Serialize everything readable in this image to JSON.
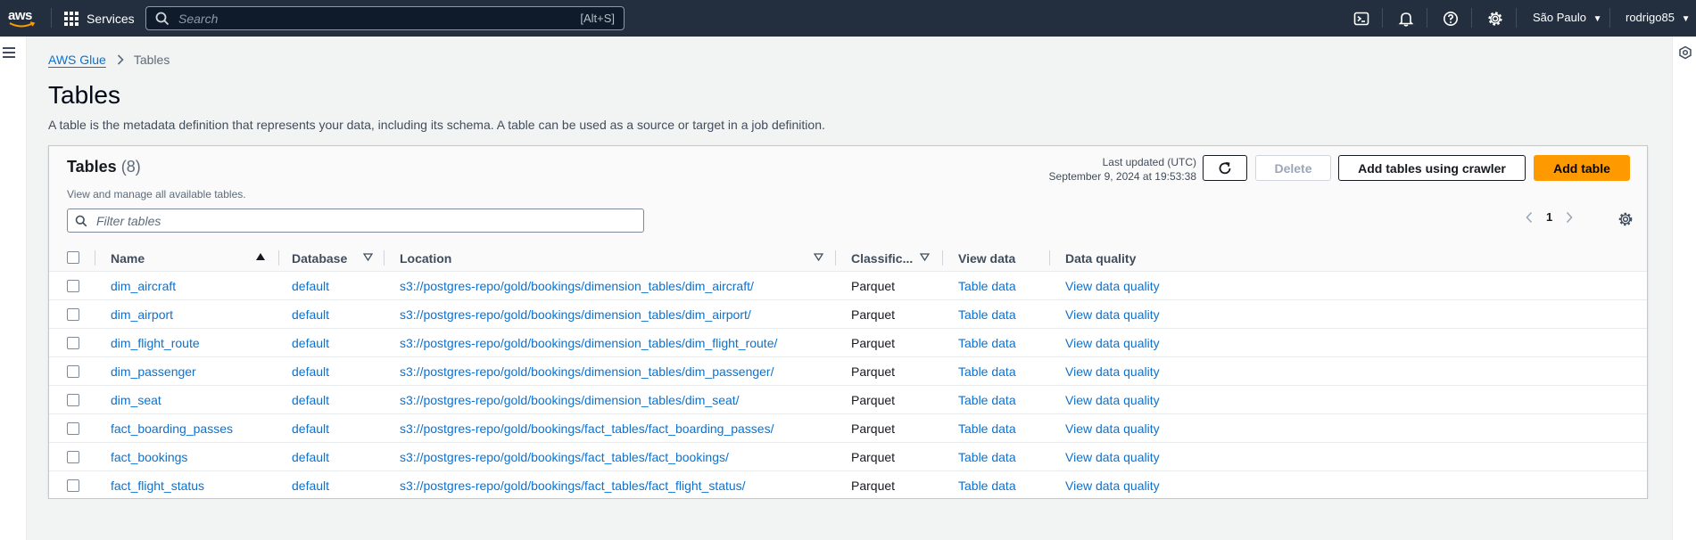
{
  "topnav": {
    "logo_text": "aws",
    "services_label": "Services",
    "search_placeholder": "Search",
    "search_shortcut": "[Alt+S]",
    "region": "São Paulo",
    "user": "rodrigo85",
    "icons": [
      "cloudshell-icon",
      "notifications-icon",
      "help-icon",
      "settings-icon"
    ]
  },
  "breadcrumb": {
    "root": "AWS Glue",
    "current": "Tables"
  },
  "page": {
    "title": "Tables",
    "description": "A table is the metadata definition that represents your data, including its schema. A table can be used as a source or target in a job definition."
  },
  "panel": {
    "title": "Tables",
    "count": "(8)",
    "subtitle": "View and manage all available tables.",
    "last_updated_label": "Last updated (UTC)",
    "last_updated_value": "September 9, 2024 at 19:53:38",
    "delete_label": "Delete",
    "crawler_label": "Add tables using crawler",
    "add_label": "Add table",
    "filter_placeholder": "Filter tables",
    "page_number": "1"
  },
  "table": {
    "columns": [
      "Name",
      "Database",
      "Location",
      "Classific...",
      "View data",
      "Data quality"
    ],
    "rows": [
      {
        "name": "dim_aircraft",
        "database": "default",
        "location": "s3://postgres-repo/gold/bookings/dimension_tables/dim_aircraft/",
        "classification": "Parquet",
        "view_data": "Table data",
        "data_quality": "View data quality"
      },
      {
        "name": "dim_airport",
        "database": "default",
        "location": "s3://postgres-repo/gold/bookings/dimension_tables/dim_airport/",
        "classification": "Parquet",
        "view_data": "Table data",
        "data_quality": "View data quality"
      },
      {
        "name": "dim_flight_route",
        "database": "default",
        "location": "s3://postgres-repo/gold/bookings/dimension_tables/dim_flight_route/",
        "classification": "Parquet",
        "view_data": "Table data",
        "data_quality": "View data quality"
      },
      {
        "name": "dim_passenger",
        "database": "default",
        "location": "s3://postgres-repo/gold/bookings/dimension_tables/dim_passenger/",
        "classification": "Parquet",
        "view_data": "Table data",
        "data_quality": "View data quality"
      },
      {
        "name": "dim_seat",
        "database": "default",
        "location": "s3://postgres-repo/gold/bookings/dimension_tables/dim_seat/",
        "classification": "Parquet",
        "view_data": "Table data",
        "data_quality": "View data quality"
      },
      {
        "name": "fact_boarding_passes",
        "database": "default",
        "location": "s3://postgres-repo/gold/bookings/fact_tables/fact_boarding_passes/",
        "classification": "Parquet",
        "view_data": "Table data",
        "data_quality": "View data quality"
      },
      {
        "name": "fact_bookings",
        "database": "default",
        "location": "s3://postgres-repo/gold/bookings/fact_tables/fact_bookings/",
        "classification": "Parquet",
        "view_data": "Table data",
        "data_quality": "View data quality"
      },
      {
        "name": "fact_flight_status",
        "database": "default",
        "location": "s3://postgres-repo/gold/bookings/fact_tables/fact_flight_status/",
        "classification": "Parquet",
        "view_data": "Table data",
        "data_quality": "View data quality"
      }
    ]
  },
  "colors": {
    "nav_bg": "#232f3e",
    "link": "#0972d3",
    "primary_button": "#ff9900",
    "page_bg": "#f2f3f3"
  }
}
